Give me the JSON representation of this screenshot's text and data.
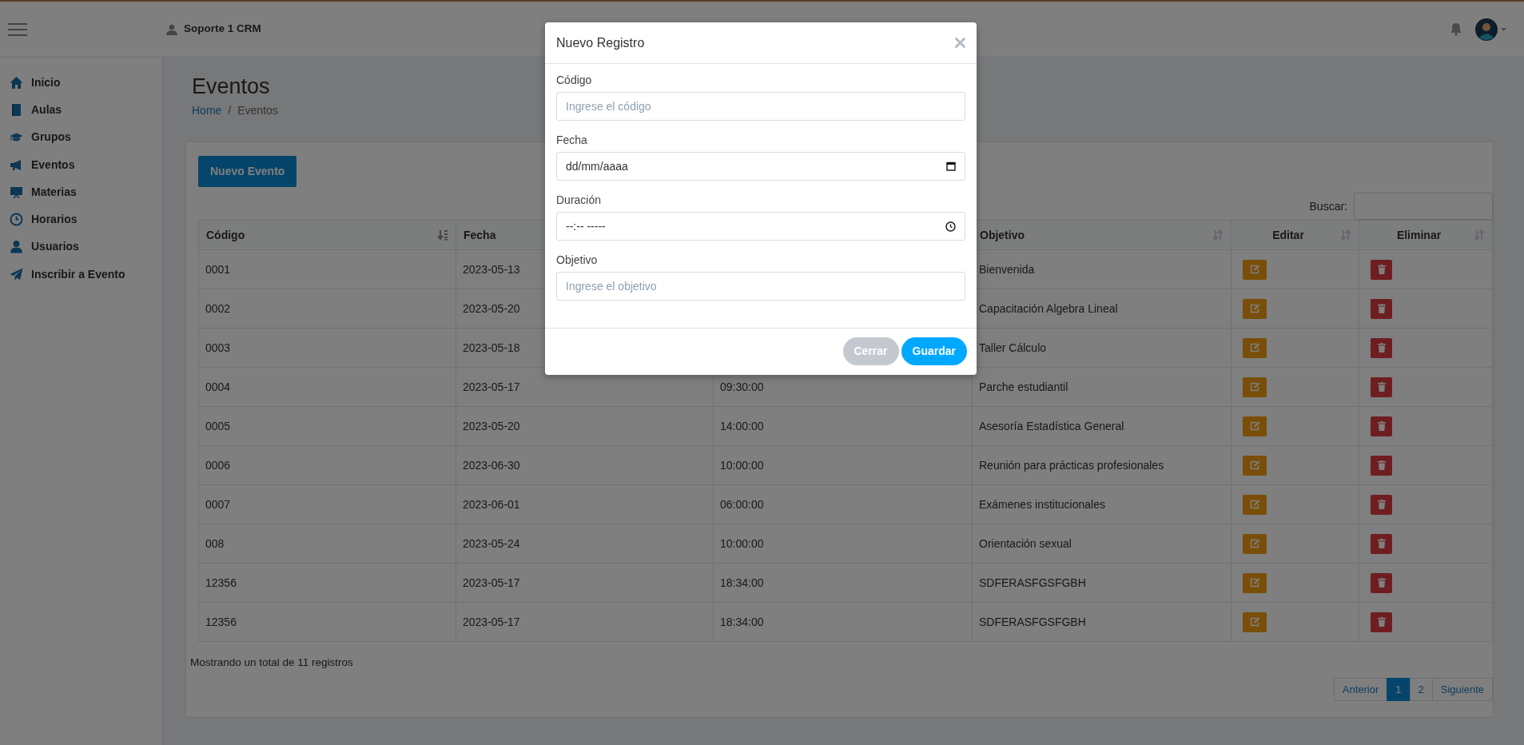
{
  "header": {
    "user": "Soporte 1 CRM"
  },
  "sidebar": {
    "items": [
      {
        "label": "Inicio"
      },
      {
        "label": "Aulas"
      },
      {
        "label": "Grupos"
      },
      {
        "label": "Eventos"
      },
      {
        "label": "Materias"
      },
      {
        "label": "Horarios"
      },
      {
        "label": "Usuarios"
      },
      {
        "label": "Inscribir a Evento"
      }
    ]
  },
  "page": {
    "title": "Eventos",
    "breadcrumb": [
      {
        "label": "Home",
        "kind": "link"
      },
      {
        "label": "/",
        "kind": "separator"
      },
      {
        "label": "Eventos",
        "kind": "current"
      }
    ]
  },
  "toolbar": {
    "new_button": "Nuevo Evento",
    "search_label": "Buscar:"
  },
  "table": {
    "columns": [
      {
        "label": "Código",
        "sorted": true
      },
      {
        "label": "Fecha"
      },
      {
        "label": "Objetivo",
        "sorted": false
      },
      {
        "label": "Editar",
        "sorted": false
      },
      {
        "label": "Eliminar",
        "sorted": false
      }
    ],
    "rows": [
      {
        "codigo": "0001",
        "fecha": "2023-05-13",
        "objetivo": "Bienvenida"
      },
      {
        "codigo": "0002",
        "fecha": "2023-05-20",
        "objetivo": "Capacitación Algebra Lineal"
      },
      {
        "codigo": "0003",
        "fecha": "2023-05-18",
        "objetivo": "Taller Cálculo"
      },
      {
        "codigo": "0004",
        "fecha": "2023-05-17",
        "hora": "09:30:00",
        "objetivo": "Parche estudiantil"
      },
      {
        "codigo": "0005",
        "fecha": "2023-05-20",
        "hora": "14:00:00",
        "objetivo": "Asesoría Estadística General"
      },
      {
        "codigo": "0006",
        "fecha": "2023-06-30",
        "hora": "10:00:00",
        "objetivo": "Reunión para prácticas profesionales"
      },
      {
        "codigo": "0007",
        "fecha": "2023-06-01",
        "hora": "06:00:00",
        "objetivo": "Exámenes institucionales"
      },
      {
        "codigo": "008",
        "fecha": "2023-05-24",
        "hora": "10:00:00",
        "objetivo": "Orientación sexual"
      },
      {
        "codigo": "12356",
        "fecha": "2023-05-17",
        "hora": "18:34:00",
        "objetivo": "SDFERASFGSFGBH"
      },
      {
        "codigo": "12356",
        "fecha": "2023-05-17",
        "hora": "18:34:00",
        "objetivo": "SDFERASFGSFGBH"
      }
    ]
  },
  "footer": {
    "info": "Mostrando un total de 11 registros",
    "pagination": [
      {
        "label": "Anterior",
        "selected": false
      },
      {
        "label": "1",
        "selected": true
      },
      {
        "label": "2",
        "selected": false
      },
      {
        "label": "Siguiente",
        "selected": false
      }
    ]
  },
  "modal": {
    "title": "Nuevo Registro",
    "fields": [
      {
        "label": "Código",
        "kind": "text",
        "placeholder": "Ingrese el código"
      },
      {
        "label": "Fecha",
        "kind": "date",
        "value": "dd/mm/aaaa"
      },
      {
        "label": "Duración",
        "kind": "time",
        "value": "--:-- -----"
      },
      {
        "label": "Objetivo",
        "kind": "text",
        "placeholder": "Ingrese el objetivo"
      }
    ],
    "buttons": [
      {
        "label": "Cerrar",
        "kind": "secondary"
      },
      {
        "label": "Guardar",
        "kind": "primary"
      }
    ]
  }
}
